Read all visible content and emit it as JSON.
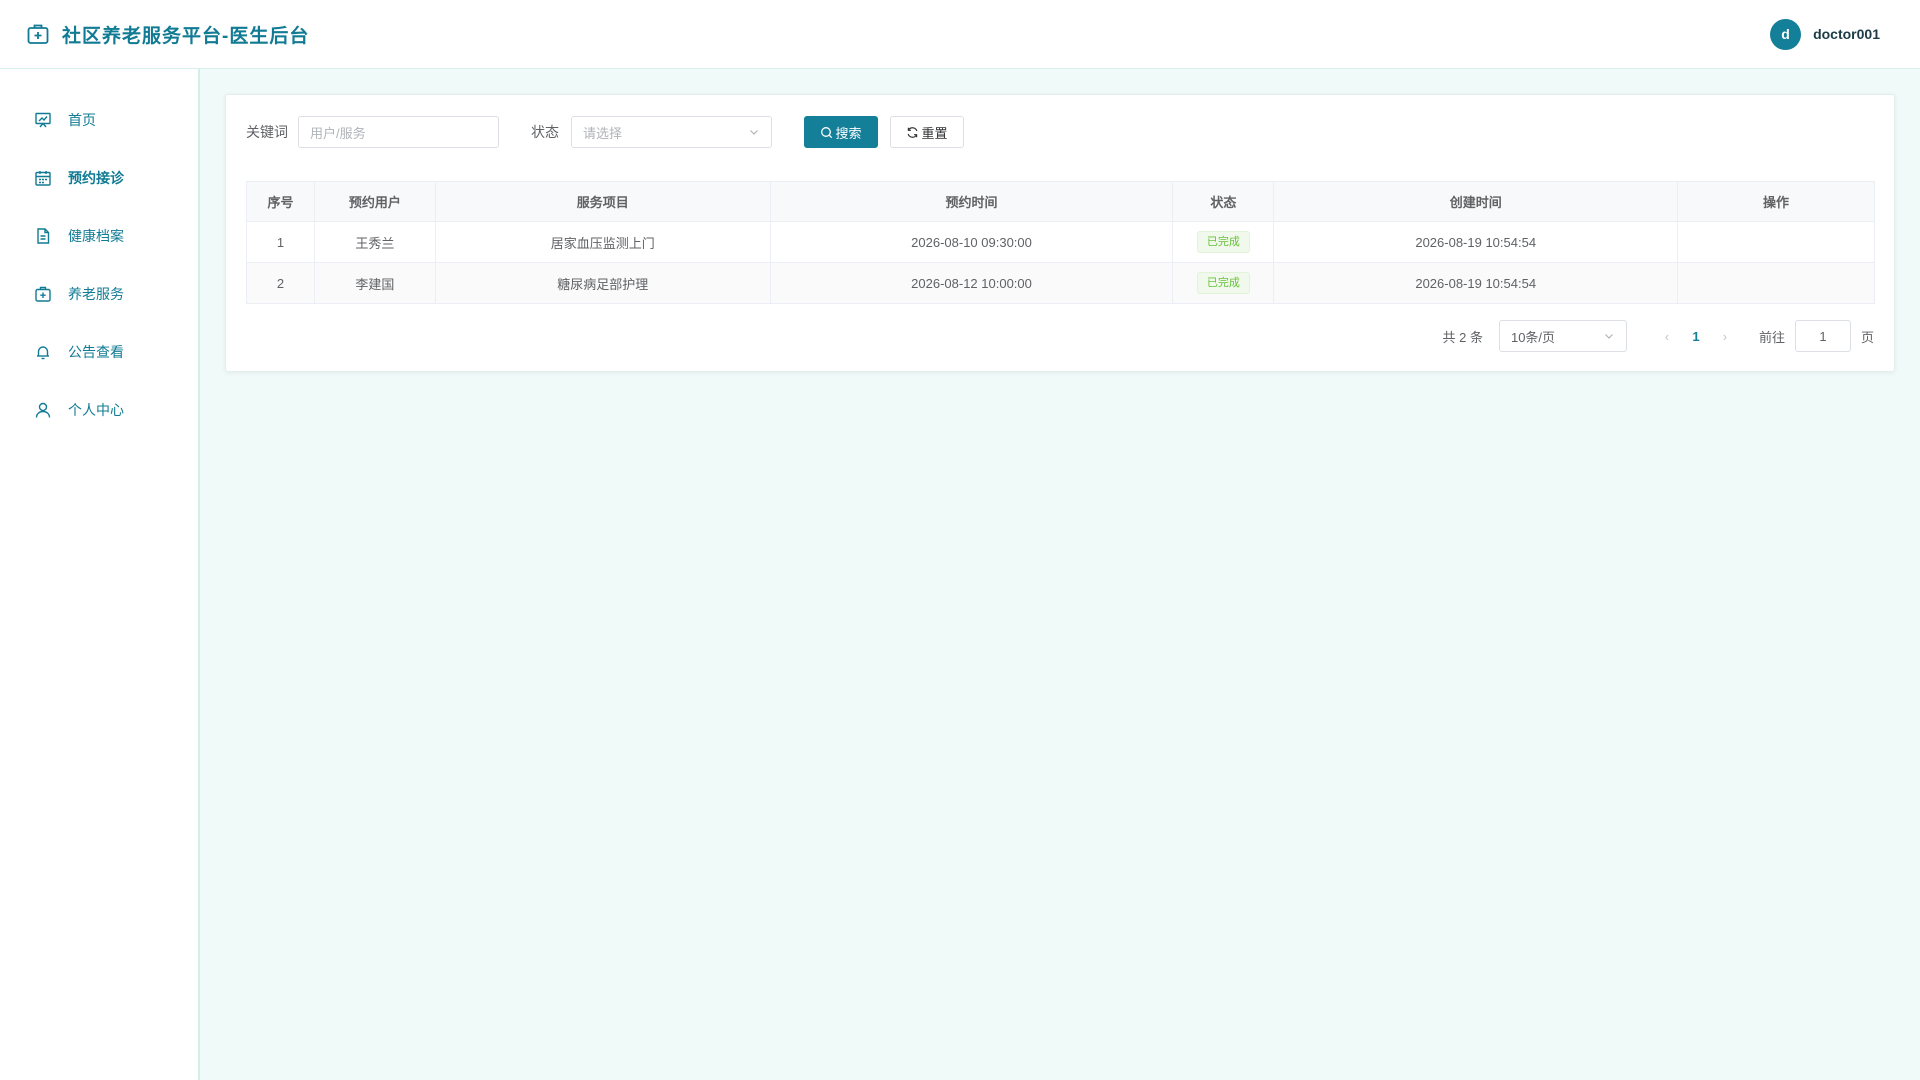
{
  "header": {
    "title": "社区养老服务平台-医生后台",
    "avatar_letter": "d",
    "username": "doctor001"
  },
  "sidebar": {
    "items": [
      {
        "label": "首页",
        "icon": "chart-board-icon"
      },
      {
        "label": "预约接诊",
        "icon": "calendar-icon",
        "active": true
      },
      {
        "label": "健康档案",
        "icon": "document-icon"
      },
      {
        "label": "养老服务",
        "icon": "medical-kit-icon"
      },
      {
        "label": "公告查看",
        "icon": "bell-icon"
      },
      {
        "label": "个人中心",
        "icon": "user-icon"
      }
    ]
  },
  "filter": {
    "keyword_label": "关键词",
    "keyword_placeholder": "用户/服务",
    "status_label": "状态",
    "status_placeholder": "请选择",
    "search_label": "搜索",
    "reset_label": "重置"
  },
  "table": {
    "columns": [
      "序号",
      "预约用户",
      "服务项目",
      "预约时间",
      "状态",
      "创建时间",
      "操作"
    ],
    "rows": [
      {
        "index": "1",
        "user": "王秀兰",
        "service": "居家血压监测上门",
        "appointment_time": "2026-08-10 09:30:00",
        "status": "已完成",
        "created_time": "2026-08-19 10:54:54",
        "actions": ""
      },
      {
        "index": "2",
        "user": "李建国",
        "service": "糖尿病足部护理",
        "appointment_time": "2026-08-12 10:00:00",
        "status": "已完成",
        "created_time": "2026-08-19 10:54:54",
        "actions": ""
      }
    ]
  },
  "pagination": {
    "total_text": "共 2 条",
    "page_size": "10条/页",
    "current_page": "1",
    "goto_label": "前往",
    "goto_value": "1",
    "page_suffix": "页"
  },
  "colors": {
    "primary": "#137f98",
    "background": "#f0faf8",
    "success_tag": "#67c23a"
  }
}
